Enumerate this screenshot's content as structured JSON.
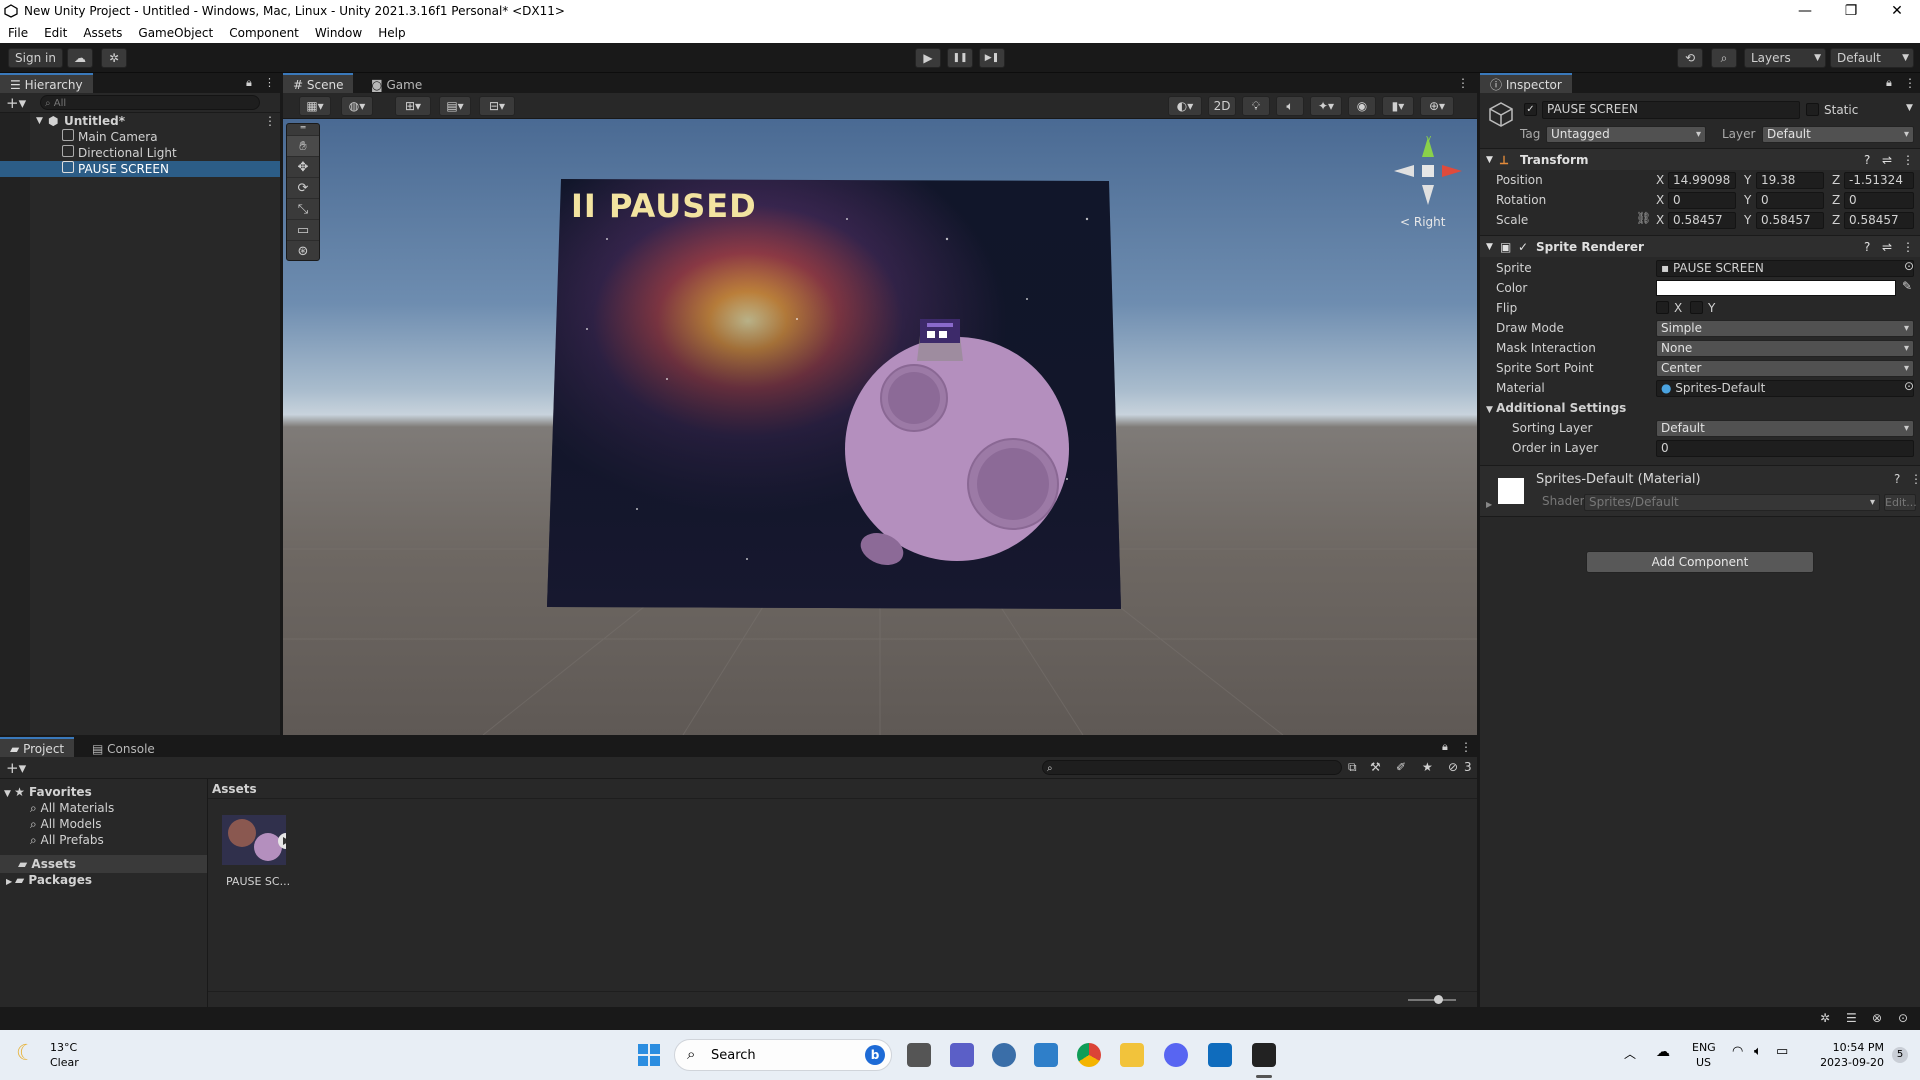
{
  "window": {
    "title": "New Unity Project - Untitled - Windows, Mac, Linux - Unity 2021.3.16f1 Personal* <DX11>",
    "minimize": "—",
    "maximize": "❐",
    "close": "✕"
  },
  "menu": [
    "File",
    "Edit",
    "Assets",
    "GameObject",
    "Component",
    "Window",
    "Help"
  ],
  "toolbar": {
    "sign_in": "Sign in",
    "layers": "Layers",
    "layout": "Default",
    "play": "▶",
    "pause": "❚❚",
    "step": "▶❚"
  },
  "hierarchy": {
    "tab": "Hierarchy",
    "search_placeholder": "All",
    "scene_name": "Untitled*",
    "items": [
      "Main Camera",
      "Directional Light",
      "PAUSE SCREEN"
    ]
  },
  "scene": {
    "tabs": [
      "Scene",
      "Game"
    ],
    "mode_2d": "2D",
    "gizmo_label": "< Right",
    "paused_text": "II PAUSED"
  },
  "inspector": {
    "tab": "Inspector",
    "object_name": "PAUSE SCREEN",
    "static_label": "Static",
    "tag_label": "Tag",
    "tag_value": "Untagged",
    "layer_label": "Layer",
    "layer_value": "Default",
    "transform": {
      "title": "Transform",
      "position_label": "Position",
      "rotation_label": "Rotation",
      "scale_label": "Scale",
      "position": {
        "x": "14.99098",
        "y": "19.38",
        "z": "-1.51324"
      },
      "rotation": {
        "x": "0",
        "y": "0",
        "z": "0"
      },
      "scale": {
        "x": "0.58457",
        "y": "0.58457",
        "z": "0.58457"
      },
      "axis_x": "X",
      "axis_y": "Y",
      "axis_z": "Z"
    },
    "sprite_renderer": {
      "title": "Sprite Renderer",
      "sprite_label": "Sprite",
      "sprite_value": "PAUSE SCREEN",
      "color_label": "Color",
      "flip_label": "Flip",
      "flip_x": "X",
      "flip_y": "Y",
      "draw_mode_label": "Draw Mode",
      "draw_mode_value": "Simple",
      "mask_label": "Mask Interaction",
      "mask_value": "None",
      "sort_point_label": "Sprite Sort Point",
      "sort_point_value": "Center",
      "material_label": "Material",
      "material_value": "Sprites-Default",
      "additional_label": "Additional Settings",
      "sorting_layer_label": "Sorting Layer",
      "sorting_layer_value": "Default",
      "order_label": "Order in Layer",
      "order_value": "0"
    },
    "material": {
      "title": "Sprites-Default (Material)",
      "shader_label": "Shader",
      "shader_value": "Sprites/Default",
      "edit_label": "Edit..."
    },
    "add_component": "Add Component"
  },
  "project": {
    "tabs": [
      "Project",
      "Console"
    ],
    "favorites_label": "Favorites",
    "favorites": [
      "All Materials",
      "All Models",
      "All Prefabs"
    ],
    "folders": [
      "Assets",
      "Packages"
    ],
    "breadcrumb": "Assets",
    "asset_name": "PAUSE SC...",
    "hidden_count": "3"
  },
  "taskbar": {
    "weather_temp": "13°C",
    "weather_desc": "Clear",
    "search_label": "Search",
    "lang": "ENG",
    "region": "US",
    "time": "10:54 PM",
    "date": "2023-09-20",
    "notif_count": "5"
  }
}
